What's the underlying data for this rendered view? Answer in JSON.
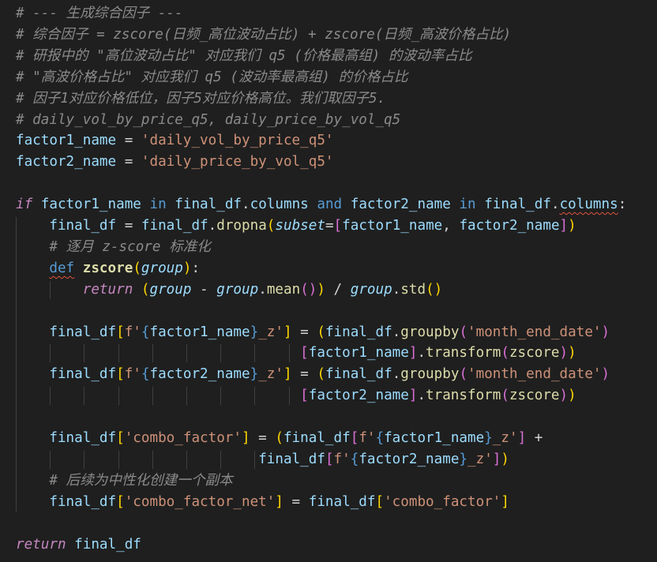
{
  "lines": [
    {
      "tokens": [
        {
          "t": "# --- 生成综合因子 ---",
          "c": "tok-comment"
        }
      ]
    },
    {
      "tokens": [
        {
          "t": "# 综合因子 = zscore(日频_高位波动占比) + zscore(日频_高波价格占比)",
          "c": "tok-comment"
        }
      ]
    },
    {
      "tokens": [
        {
          "t": "# 研报中的 \"高位波动占比\" 对应我们 q5 (价格最高组) 的波动率占比",
          "c": "tok-comment"
        }
      ]
    },
    {
      "tokens": [
        {
          "t": "# \"高波价格占比\" 对应我们 q5 (波动率最高组) 的价格占比",
          "c": "tok-comment"
        }
      ]
    },
    {
      "tokens": [
        {
          "t": "# 因子1对应价格低位，因子5对应价格高位。我们取因子5.",
          "c": "tok-comment"
        }
      ]
    },
    {
      "tokens": [
        {
          "t": "# daily_vol_by_price_q5, daily_price_by_vol_q5",
          "c": "tok-comment"
        }
      ]
    },
    {
      "tokens": [
        {
          "t": "factor1_name",
          "c": "tok-var"
        },
        {
          "t": " = ",
          "c": "tok-op"
        },
        {
          "t": "'daily_vol_by_price_q5'",
          "c": "tok-str"
        }
      ]
    },
    {
      "tokens": [
        {
          "t": "factor2_name",
          "c": "tok-var"
        },
        {
          "t": " = ",
          "c": "tok-op"
        },
        {
          "t": "'daily_price_by_vol_q5'",
          "c": "tok-str"
        }
      ]
    },
    {
      "tokens": []
    },
    {
      "tokens": [
        {
          "t": "if",
          "c": "tok-ctrl"
        },
        {
          "t": " ",
          "c": "tok-op"
        },
        {
          "t": "factor1_name",
          "c": "tok-var"
        },
        {
          "t": " in ",
          "c": "tok-kw"
        },
        {
          "t": "final_df",
          "c": "tok-var"
        },
        {
          "t": ".",
          "c": "tok-op"
        },
        {
          "t": "columns",
          "c": "tok-var"
        },
        {
          "t": " and ",
          "c": "tok-kw"
        },
        {
          "t": "factor2_name",
          "c": "tok-var"
        },
        {
          "t": " in ",
          "c": "tok-kw"
        },
        {
          "t": "final_df",
          "c": "tok-var"
        },
        {
          "t": ".",
          "c": "tok-op"
        },
        {
          "t": "columns",
          "c": "tok-var squiggle"
        },
        {
          "t": ":",
          "c": "tok-op"
        }
      ]
    },
    {
      "tokens": [
        {
          "t": "    final_df",
          "c": "tok-var"
        },
        {
          "t": " = ",
          "c": "tok-op"
        },
        {
          "t": "final_df",
          "c": "tok-var"
        },
        {
          "t": ".",
          "c": "tok-op"
        },
        {
          "t": "dropna",
          "c": "tok-fn"
        },
        {
          "t": "(",
          "c": "tok-br1"
        },
        {
          "t": "subset",
          "c": "tok-param"
        },
        {
          "t": "=",
          "c": "tok-op"
        },
        {
          "t": "[",
          "c": "tok-br2"
        },
        {
          "t": "factor1_name",
          "c": "tok-var"
        },
        {
          "t": ", ",
          "c": "tok-op"
        },
        {
          "t": "factor2_name",
          "c": "tok-var"
        },
        {
          "t": "]",
          "c": "tok-br2"
        },
        {
          "t": ")",
          "c": "tok-br1"
        }
      ]
    },
    {
      "tokens": [
        {
          "t": "    # 逐月 z-score 标准化",
          "c": "tok-comment"
        }
      ]
    },
    {
      "tokens": [
        {
          "t": "    ",
          "c": "tok-op"
        },
        {
          "t": "def",
          "c": "tok-kw squiggle"
        },
        {
          "t": " ",
          "c": "tok-op"
        },
        {
          "t": "zscore",
          "c": "tok-fn-bold"
        },
        {
          "t": "(",
          "c": "tok-br1"
        },
        {
          "t": "group",
          "c": "tok-param"
        },
        {
          "t": ")",
          "c": "tok-br1"
        },
        {
          "t": ":",
          "c": "tok-op"
        }
      ]
    },
    {
      "tokens": [
        {
          "t": "        ",
          "c": "tok-op"
        },
        {
          "t": "return",
          "c": "tok-ctrl"
        },
        {
          "t": " ",
          "c": "tok-op"
        },
        {
          "t": "(",
          "c": "tok-br1"
        },
        {
          "t": "group",
          "c": "tok-param"
        },
        {
          "t": " - ",
          "c": "tok-op"
        },
        {
          "t": "group",
          "c": "tok-param"
        },
        {
          "t": ".",
          "c": "tok-op"
        },
        {
          "t": "mean",
          "c": "tok-fn"
        },
        {
          "t": "()",
          "c": "tok-br2"
        },
        {
          "t": ")",
          "c": "tok-br1"
        },
        {
          "t": " / ",
          "c": "tok-op"
        },
        {
          "t": "group",
          "c": "tok-param"
        },
        {
          "t": ".",
          "c": "tok-op"
        },
        {
          "t": "std",
          "c": "tok-fn"
        },
        {
          "t": "()",
          "c": "tok-br1"
        }
      ]
    },
    {
      "tokens": []
    },
    {
      "tokens": [
        {
          "t": "    final_df",
          "c": "tok-var"
        },
        {
          "t": "[",
          "c": "tok-br1"
        },
        {
          "t": "f'",
          "c": "tok-str"
        },
        {
          "t": "{",
          "c": "tok-brace"
        },
        {
          "t": "factor1_name",
          "c": "tok-var"
        },
        {
          "t": "}",
          "c": "tok-brace"
        },
        {
          "t": "_z'",
          "c": "tok-str"
        },
        {
          "t": "]",
          "c": "tok-br1"
        },
        {
          "t": " = ",
          "c": "tok-op"
        },
        {
          "t": "(",
          "c": "tok-br1"
        },
        {
          "t": "final_df",
          "c": "tok-var"
        },
        {
          "t": ".",
          "c": "tok-op"
        },
        {
          "t": "groupby",
          "c": "tok-fn"
        },
        {
          "t": "(",
          "c": "tok-br2"
        },
        {
          "t": "'month_end_date'",
          "c": "tok-str"
        },
        {
          "t": ")",
          "c": "tok-br2"
        }
      ]
    },
    {
      "tokens": [
        {
          "t": "                                  ",
          "c": "tok-op"
        },
        {
          "t": "[",
          "c": "tok-br2"
        },
        {
          "t": "factor1_name",
          "c": "tok-var"
        },
        {
          "t": "]",
          "c": "tok-br2"
        },
        {
          "t": ".",
          "c": "tok-op"
        },
        {
          "t": "transform",
          "c": "tok-fn"
        },
        {
          "t": "(",
          "c": "tok-br2"
        },
        {
          "t": "zscore",
          "c": "tok-fn"
        },
        {
          "t": ")",
          "c": "tok-br2"
        },
        {
          "t": ")",
          "c": "tok-br1"
        }
      ]
    },
    {
      "tokens": [
        {
          "t": "    final_df",
          "c": "tok-var"
        },
        {
          "t": "[",
          "c": "tok-br1"
        },
        {
          "t": "f'",
          "c": "tok-str"
        },
        {
          "t": "{",
          "c": "tok-brace"
        },
        {
          "t": "factor2_name",
          "c": "tok-var"
        },
        {
          "t": "}",
          "c": "tok-brace"
        },
        {
          "t": "_z'",
          "c": "tok-str"
        },
        {
          "t": "]",
          "c": "tok-br1"
        },
        {
          "t": " = ",
          "c": "tok-op"
        },
        {
          "t": "(",
          "c": "tok-br1"
        },
        {
          "t": "final_df",
          "c": "tok-var"
        },
        {
          "t": ".",
          "c": "tok-op"
        },
        {
          "t": "groupby",
          "c": "tok-fn"
        },
        {
          "t": "(",
          "c": "tok-br2"
        },
        {
          "t": "'month_end_date'",
          "c": "tok-str"
        },
        {
          "t": ")",
          "c": "tok-br2"
        }
      ]
    },
    {
      "tokens": [
        {
          "t": "                                  ",
          "c": "tok-op"
        },
        {
          "t": "[",
          "c": "tok-br2"
        },
        {
          "t": "factor2_name",
          "c": "tok-var"
        },
        {
          "t": "]",
          "c": "tok-br2"
        },
        {
          "t": ".",
          "c": "tok-op"
        },
        {
          "t": "transform",
          "c": "tok-fn"
        },
        {
          "t": "(",
          "c": "tok-br2"
        },
        {
          "t": "zscore",
          "c": "tok-fn"
        },
        {
          "t": ")",
          "c": "tok-br2"
        },
        {
          "t": ")",
          "c": "tok-br1"
        }
      ]
    },
    {
      "tokens": []
    },
    {
      "tokens": [
        {
          "t": "    final_df",
          "c": "tok-var"
        },
        {
          "t": "[",
          "c": "tok-br1"
        },
        {
          "t": "'combo_factor'",
          "c": "tok-str"
        },
        {
          "t": "]",
          "c": "tok-br1"
        },
        {
          "t": " = ",
          "c": "tok-op"
        },
        {
          "t": "(",
          "c": "tok-br1"
        },
        {
          "t": "final_df",
          "c": "tok-var"
        },
        {
          "t": "[",
          "c": "tok-br2"
        },
        {
          "t": "f'",
          "c": "tok-str"
        },
        {
          "t": "{",
          "c": "tok-brace"
        },
        {
          "t": "factor1_name",
          "c": "tok-var"
        },
        {
          "t": "}",
          "c": "tok-brace"
        },
        {
          "t": "_z'",
          "c": "tok-str"
        },
        {
          "t": "]",
          "c": "tok-br2"
        },
        {
          "t": " +",
          "c": "tok-op"
        }
      ]
    },
    {
      "tokens": [
        {
          "t": "                             ",
          "c": "tok-op"
        },
        {
          "t": "final_df",
          "c": "tok-var"
        },
        {
          "t": "[",
          "c": "tok-br2"
        },
        {
          "t": "f'",
          "c": "tok-str"
        },
        {
          "t": "{",
          "c": "tok-brace"
        },
        {
          "t": "factor2_name",
          "c": "tok-var"
        },
        {
          "t": "}",
          "c": "tok-brace"
        },
        {
          "t": "_z'",
          "c": "tok-str"
        },
        {
          "t": "]",
          "c": "tok-br2"
        },
        {
          "t": ")",
          "c": "tok-br1"
        }
      ]
    },
    {
      "tokens": [
        {
          "t": "    # 后续为中性化创建一个副本",
          "c": "tok-comment"
        }
      ]
    },
    {
      "tokens": [
        {
          "t": "    final_df",
          "c": "tok-var"
        },
        {
          "t": "[",
          "c": "tok-br1"
        },
        {
          "t": "'combo_factor_net'",
          "c": "tok-str"
        },
        {
          "t": "]",
          "c": "tok-br1"
        },
        {
          "t": " = ",
          "c": "tok-op"
        },
        {
          "t": "final_df",
          "c": "tok-var"
        },
        {
          "t": "[",
          "c": "tok-br1"
        },
        {
          "t": "'combo_factor'",
          "c": "tok-str"
        },
        {
          "t": "]",
          "c": "tok-br1"
        }
      ]
    },
    {
      "tokens": []
    },
    {
      "tokens": [
        {
          "t": "return",
          "c": "tok-ctrl"
        },
        {
          "t": " ",
          "c": "tok-op"
        },
        {
          "t": "final_df",
          "c": "tok-var"
        }
      ]
    }
  ]
}
